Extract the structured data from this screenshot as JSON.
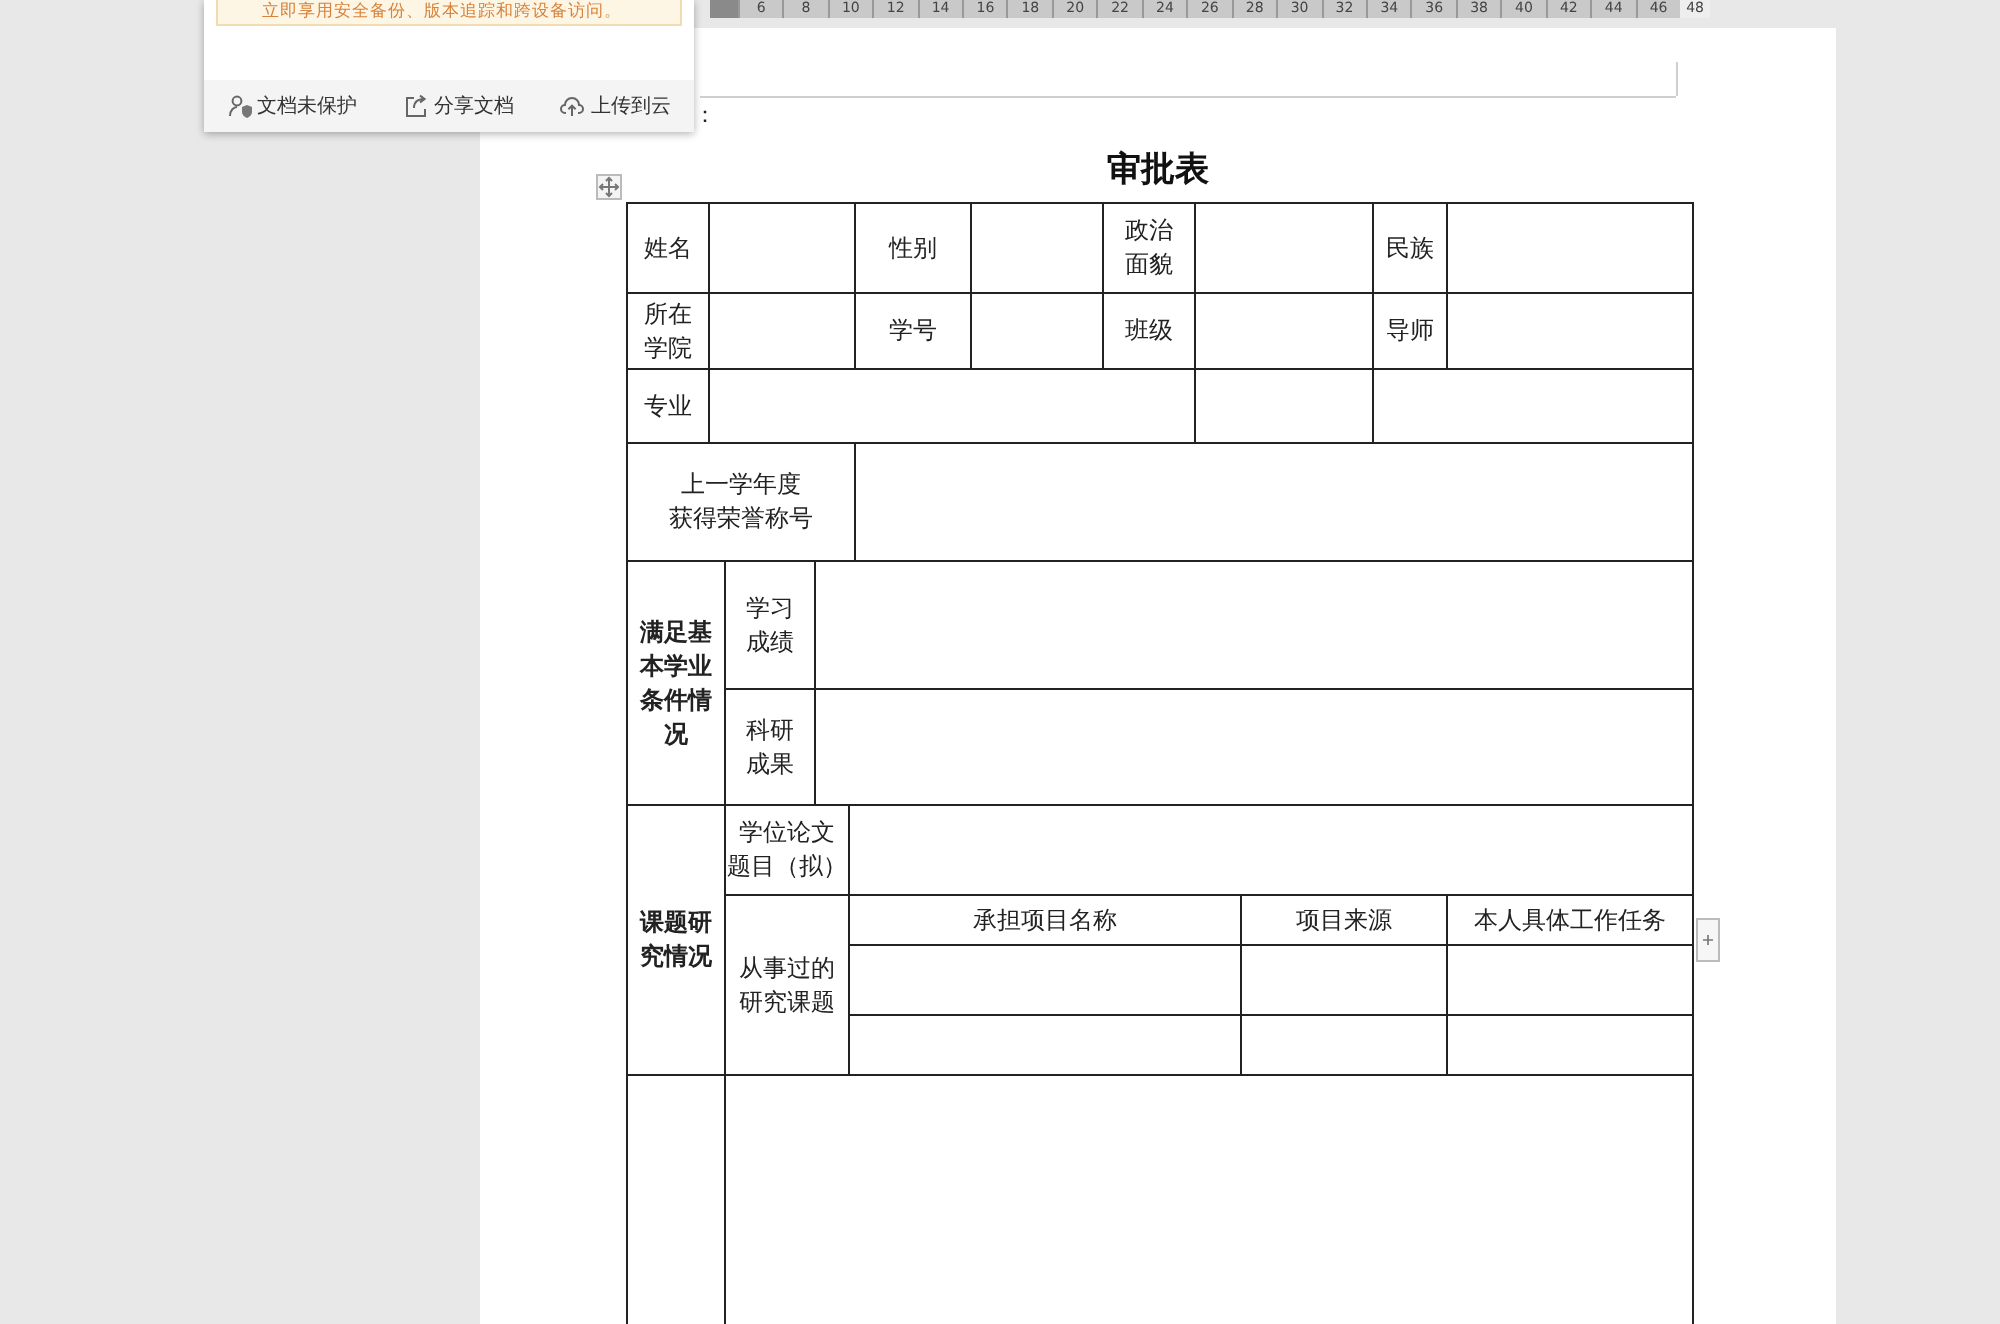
{
  "popup": {
    "notice": "立即享用安全备份、版本追踪和跨设备访问。",
    "actions": [
      {
        "kind": "protect",
        "label": "文档未保护"
      },
      {
        "kind": "share",
        "label": "分享文档"
      },
      {
        "kind": "upload",
        "label": "上传到云"
      }
    ]
  },
  "ruler": {
    "labels": [
      "6",
      "8",
      "10",
      "12",
      "14",
      "16",
      "18",
      "20",
      "22",
      "24",
      "26",
      "28",
      "30",
      "32",
      "34",
      "36",
      "38",
      "40",
      "42",
      "44",
      "46"
    ],
    "end_label": "48"
  },
  "document": {
    "cut_text": "：",
    "title": "审批表",
    "cells": [
      {
        "lines": [
          "姓名"
        ]
      },
      {
        "lines": [
          "性别"
        ]
      },
      {
        "lines": [
          "政治",
          "面貌"
        ]
      },
      {
        "lines": [
          "民族"
        ]
      },
      {
        "lines": [
          "所在",
          "学院"
        ]
      },
      {
        "lines": [
          "学号"
        ]
      },
      {
        "lines": [
          "班级"
        ]
      },
      {
        "lines": [
          "导师"
        ]
      },
      {
        "lines": [
          "专业"
        ]
      },
      {
        "lines": [
          "上一学年度",
          "获得荣誉称号"
        ]
      },
      {
        "lines": [
          "满足基",
          "本学业",
          "条件情",
          "况"
        ],
        "kind": "section"
      },
      {
        "lines": [
          "学习",
          "成绩"
        ]
      },
      {
        "lines": [
          "科研",
          "成果"
        ]
      },
      {
        "lines": [
          "课题研",
          "究情况"
        ],
        "kind": "section"
      },
      {
        "lines": [
          "学位论文",
          "题目（拟）"
        ]
      },
      {
        "lines": [
          "从事过的",
          "研究课题"
        ]
      },
      {
        "lines": [
          "承担项目名称"
        ]
      },
      {
        "lines": [
          "项目来源"
        ]
      },
      {
        "lines": [
          "本人具体工作任务"
        ]
      }
    ]
  }
}
